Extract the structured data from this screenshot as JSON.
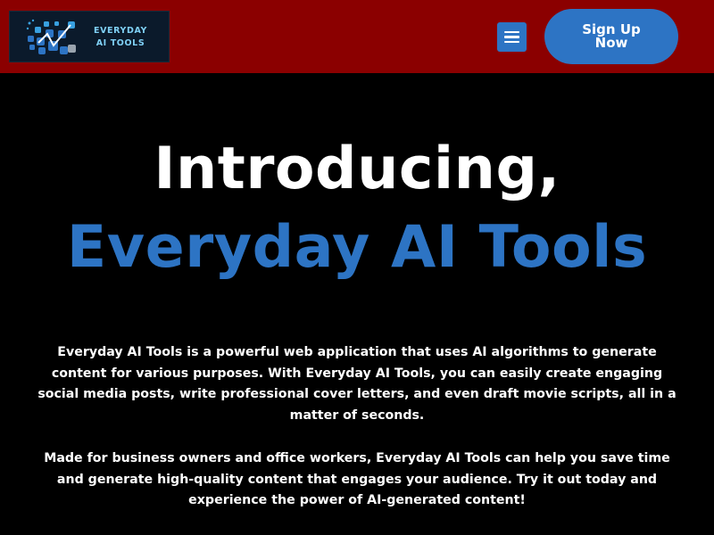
{
  "header": {
    "logo_text_line1": "EVERYDAY",
    "logo_text_line2": "AI TOOLS",
    "menu_icon": "hamburger-menu-icon",
    "signup_label": "Sign Up Now"
  },
  "hero": {
    "line1": "Introducing,",
    "line2": "Everyday AI Tools"
  },
  "content": {
    "paragraph1": "Everyday AI Tools is a powerful web application that uses AI algorithms to generate content for various purposes. With Everyday AI Tools, you can easily create engaging social media posts, write professional cover letters, and even draft movie scripts, all in a matter of seconds.",
    "paragraph2": "Made for business owners and office workers, Everyday AI Tools can help you save time and generate high-quality content that engages your audience. Try it out today and experience the power of AI-generated content!"
  },
  "colors": {
    "header_bg": "#8b0000",
    "accent_blue": "#2d74c4",
    "page_bg": "#000000",
    "logo_bg": "#0b1a2b"
  }
}
